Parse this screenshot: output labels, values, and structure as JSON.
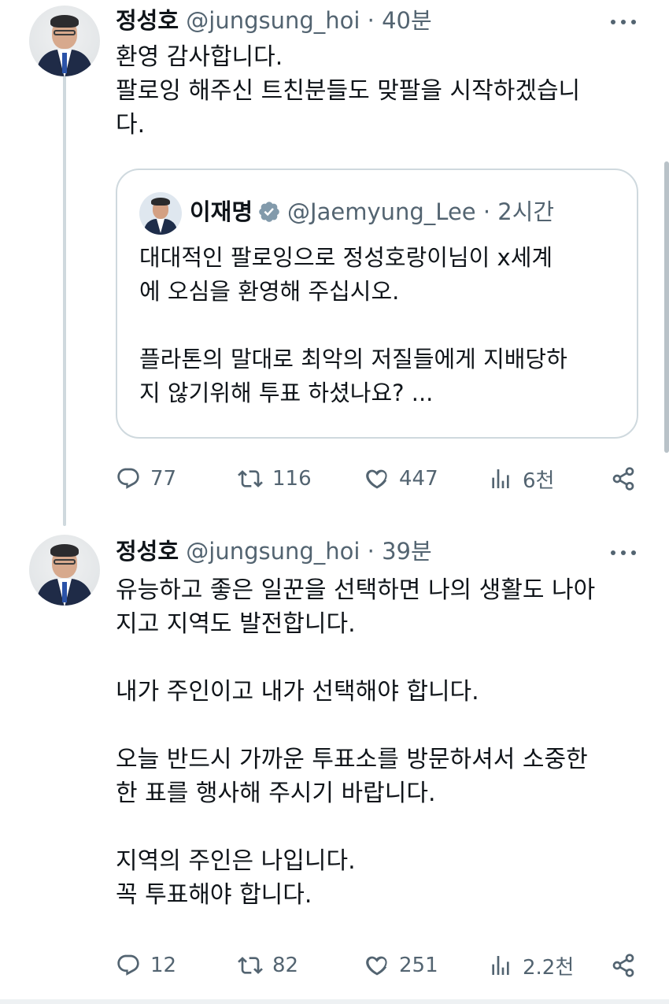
{
  "tweet1": {
    "name": "정성호",
    "handle": "@jungsung_hoi",
    "sep": "·",
    "time": "40분",
    "lines": [
      "환영 감사합니다.",
      "팔로잉 해주신 트친분들도 맞팔을 시작하겠습니",
      "다."
    ],
    "quote": {
      "name": "이재명",
      "handle": "@Jaemyung_Lee",
      "sep": "·",
      "time": "2시간",
      "lines": [
        "대대적인 팔로잉으로 정성호랑이님이 x세계",
        "에 오심을 환영해 주십시오.",
        "",
        "플라톤의 말대로 최악의 저질들에게 지배당하",
        "지 않기위해 투표 하셨나요? ..."
      ]
    },
    "stats": {
      "replies": "77",
      "retweets": "116",
      "likes": "447",
      "views": "6천"
    }
  },
  "tweet2": {
    "name": "정성호",
    "handle": "@jungsung_hoi",
    "sep": "·",
    "time": "39분",
    "lines": [
      "유능하고 좋은 일꾼을 선택하면 나의 생활도 나아",
      "지고 지역도 발전합니다.",
      "",
      "내가 주인이고 내가 선택해야 합니다.",
      "",
      "오늘 반드시 가까운 투표소를 방문하셔서 소중한",
      "한 표를 행사해 주시기 바랍니다.",
      "",
      "지역의 주인은 나입니다.",
      "꼭 투표해야 합니다."
    ],
    "stats": {
      "replies": "12",
      "retweets": "82",
      "likes": "251",
      "views": "2.2천"
    }
  },
  "colors": {
    "text": "#0f1419",
    "secondary": "#536471",
    "border": "#cfd9de",
    "verified": "#829aab"
  },
  "icons": [
    "reply-icon",
    "retweet-icon",
    "like-icon",
    "views-icon",
    "share-icon",
    "more-icon",
    "verified-badge-icon"
  ]
}
